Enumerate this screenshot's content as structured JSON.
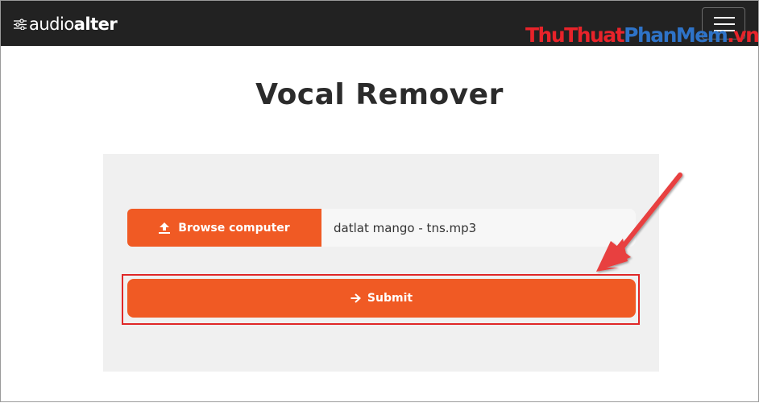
{
  "brand": {
    "name_part1": "audio",
    "name_part2": "alter",
    "icon": "sliders-icon"
  },
  "navbar": {
    "menu_icon": "hamburger-menu-icon"
  },
  "watermark": {
    "part1": "ThuThuat",
    "part2": "PhanMem",
    "part3": ".vn"
  },
  "page": {
    "title": "Vocal Remover"
  },
  "upload": {
    "browse_label": "Browse computer",
    "browse_icon": "upload-icon",
    "file_name": "datlat mango - tns.mp3"
  },
  "submit": {
    "label": "Submit",
    "icon": "arrow-right-icon"
  },
  "colors": {
    "navbar": "#222222",
    "accent": "#f05a24",
    "panel": "#f0f0f0",
    "annotation": "#e02727"
  }
}
